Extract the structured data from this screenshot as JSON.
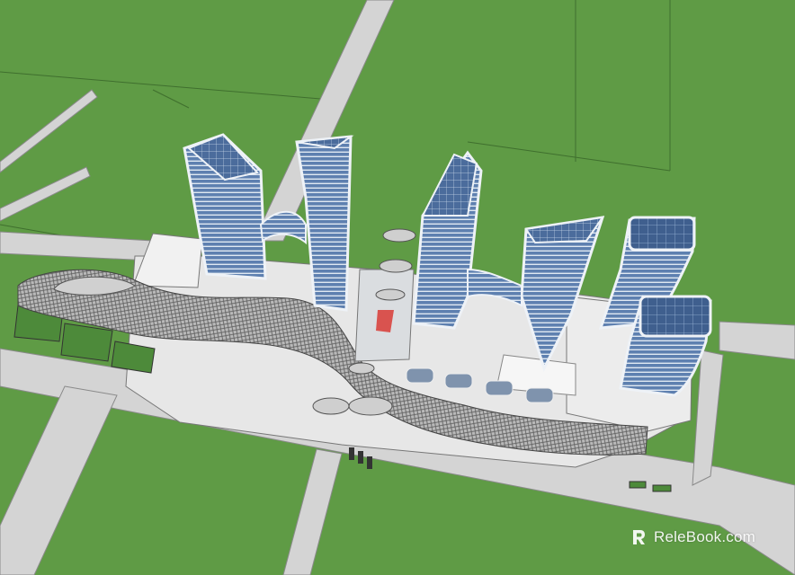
{
  "scene": {
    "description_free": true,
    "watermark": {
      "text": "ReleBook.com"
    },
    "colors": {
      "grass": "#5f9b45",
      "road": "#d4d4d4",
      "glass": "#4f6f9e",
      "glass_light": "#8fb0d6",
      "canopy": "#9a9a9a",
      "frame": "#f2f2f2"
    }
  }
}
